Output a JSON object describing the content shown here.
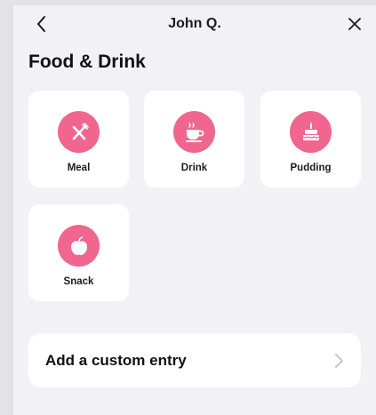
{
  "header": {
    "title": "John Q.",
    "back_icon": "chevron-left-icon",
    "close_icon": "close-icon"
  },
  "page": {
    "title": "Food & Drink"
  },
  "categories": [
    {
      "label": "Meal",
      "icon": "fork-knife-icon"
    },
    {
      "label": "Drink",
      "icon": "coffee-cup-icon"
    },
    {
      "label": "Pudding",
      "icon": "cake-icon"
    },
    {
      "label": "Snack",
      "icon": "apple-icon"
    }
  ],
  "custom_entry": {
    "label": "Add a custom entry",
    "icon": "chevron-right-icon"
  },
  "colors": {
    "accent": "#f0668f",
    "background": "#f2f2f6",
    "tile": "#ffffff"
  }
}
